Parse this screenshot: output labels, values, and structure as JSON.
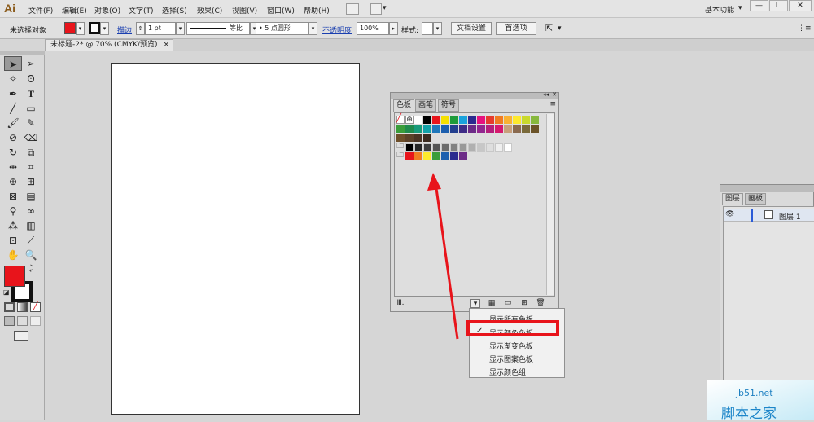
{
  "app": {
    "logo": "Ai",
    "workspace": "基本功能"
  },
  "menubar": {
    "items": [
      "文件(F)",
      "编辑(E)",
      "对象(O)",
      "文字(T)",
      "选择(S)",
      "效果(C)",
      "视图(V)",
      "窗口(W)",
      "帮助(H)"
    ],
    "workspace_dropdown": "▾",
    "window_buttons": [
      "—",
      "❐",
      "✕"
    ]
  },
  "controlbar": {
    "no_selection": "未选择对象",
    "stroke_label": "描边",
    "stroke_weight": "1 pt",
    "profile": "等比",
    "brush": "5 点圆形",
    "opacity_label": "不透明度",
    "opacity_value": "100%",
    "style_label": "样式:",
    "doc_setup": "文档设置",
    "preferences": "首选项"
  },
  "document_tab": {
    "title": "未标题-2* @ 70% (CMYK/预览)",
    "close": "×"
  },
  "colors": {
    "fill": "#e8141b",
    "highlight": "#e8141b",
    "arrow": "#e8141b"
  },
  "swatch_panel": {
    "collapse_icon": "◂◂",
    "close_icon": "✕",
    "tabs": [
      "色板",
      "画笔",
      "符号"
    ],
    "menu_icon": "≡",
    "row1": [
      "#ffffff",
      "#000000",
      "#e8141b",
      "#f5e000",
      "#1e9b3a",
      "#1aa2dc",
      "#2b2b8f",
      "#e6127e",
      "#e63b2e",
      "#f07c22",
      "#f9b233",
      "#fde92d",
      "#c9d92b",
      "#87b83d"
    ],
    "row2": [
      "#3a9d3a",
      "#1f8a4c",
      "#189a7a",
      "#12a1a8",
      "#1f77bb",
      "#1d5fae",
      "#233f8f",
      "#3e2c86",
      "#6c2b87",
      "#92278f",
      "#b41f7b",
      "#d6196e",
      "#c8a07c",
      "#8a6a4f",
      "#7a6a3a",
      "#6b5328"
    ],
    "row3": [
      "#6e4f2a",
      "#5c4128",
      "#4a3424",
      "#3a2a1f"
    ],
    "gray_row": [
      "#000000",
      "#262626",
      "#3d3d3d",
      "#545454",
      "#6b6b6b",
      "#828282",
      "#999999",
      "#b0b0b0",
      "#c7c7c7",
      "#dedede",
      "#efefef",
      "#ffffff"
    ],
    "color_group": [
      "#e8141b",
      "#f07c22",
      "#fde92d",
      "#3a9d3a",
      "#1d5fae",
      "#2b2b8f",
      "#6c2b87"
    ],
    "footer_icons": [
      "library-icon",
      "show-kind-icon",
      "swatch-options-icon",
      "new-group-icon",
      "new-swatch-icon",
      "delete-icon"
    ]
  },
  "dropdown_menu": {
    "items": [
      "显示所有色板",
      "显示颜色色板",
      "显示渐变色板",
      "显示图案色板",
      "显示颜色组"
    ],
    "checked_index": 1,
    "check_mark": "✓"
  },
  "layers_panel": {
    "tabs": [
      "图层",
      "画板"
    ],
    "layer_name": "图层 1"
  },
  "watermark": {
    "url": "jb51.net",
    "name": "脚本之家"
  }
}
